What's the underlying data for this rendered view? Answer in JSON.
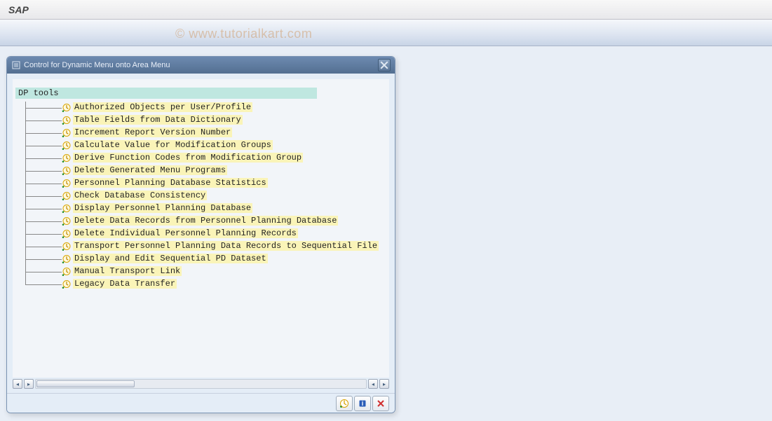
{
  "header": {
    "title": "SAP"
  },
  "watermark": "© www.tutorialkart.com",
  "dialog": {
    "title": "Control for Dynamic Menu onto Area Menu",
    "root_label": "DP tools",
    "items": [
      {
        "label": "Authorized Objects per User/Profile"
      },
      {
        "label": "Table Fields from Data Dictionary"
      },
      {
        "label": "Increment Report Version Number"
      },
      {
        "label": "Calculate Value for Modification Groups"
      },
      {
        "label": "Derive Function Codes from Modification Group"
      },
      {
        "label": "Delete Generated Menu Programs"
      },
      {
        "label": "Personnel Planning Database Statistics"
      },
      {
        "label": "Check Database Consistency"
      },
      {
        "label": "Display Personnel Planning Database"
      },
      {
        "label": "Delete Data Records from Personnel Planning Database"
      },
      {
        "label": "Delete Individual Personnel Planning Records"
      },
      {
        "label": "Transport Personnel Planning Data Records to Sequential File"
      },
      {
        "label": "Display and Edit Sequential PD Dataset"
      },
      {
        "label": "Manual Transport Link"
      },
      {
        "label": "Legacy Data Transfer"
      }
    ]
  }
}
